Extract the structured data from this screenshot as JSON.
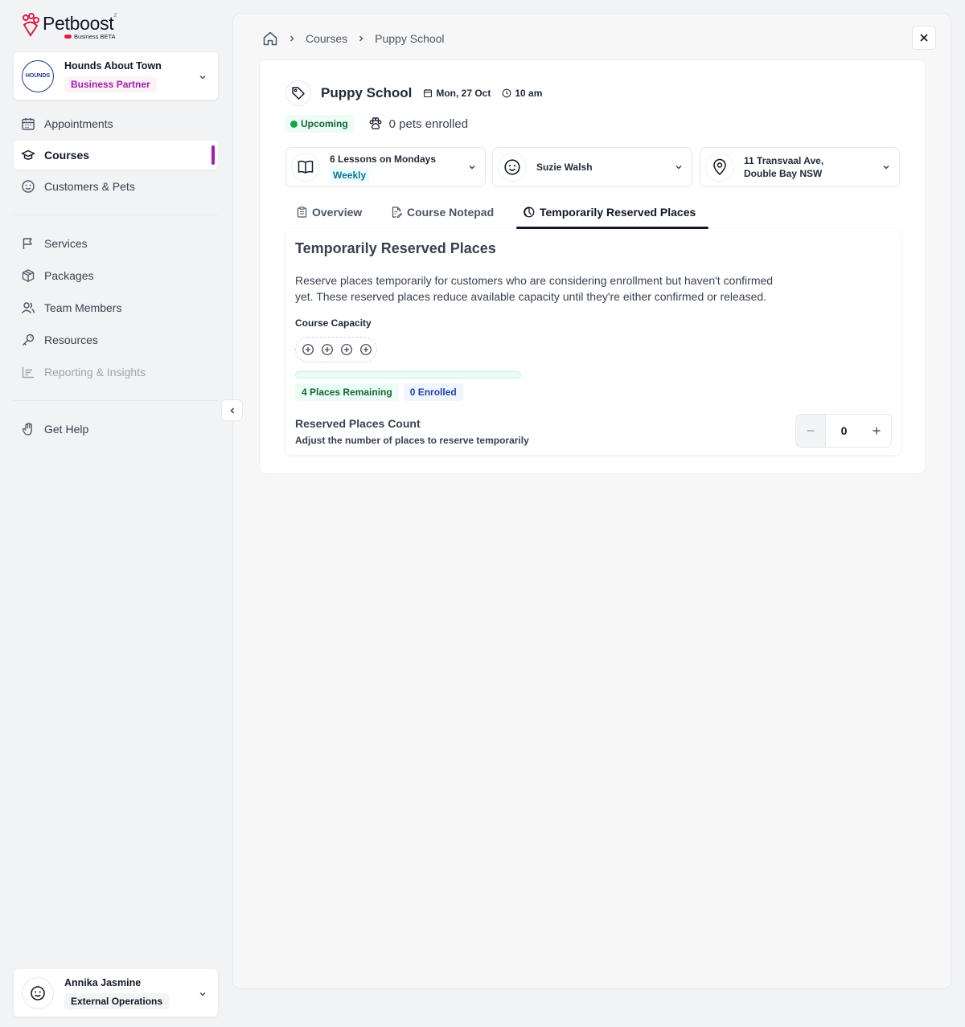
{
  "brand": {
    "name": "Petboost",
    "sup": "2",
    "sub": "Business BETA"
  },
  "org": {
    "name": "Hounds About Town",
    "badge": "Business Partner",
    "logo_text": "HOUNDS"
  },
  "nav": {
    "primary": [
      {
        "label": "Appointments",
        "icon": "calendar-icon"
      },
      {
        "label": "Courses",
        "icon": "graduation-cap-icon",
        "active": true
      },
      {
        "label": "Customers & Pets",
        "icon": "smiley-icon"
      }
    ],
    "secondary": [
      {
        "label": "Services",
        "icon": "flag-icon"
      },
      {
        "label": "Packages",
        "icon": "box-icon"
      },
      {
        "label": "Team Members",
        "icon": "users-icon"
      },
      {
        "label": "Resources",
        "icon": "key-icon"
      },
      {
        "label": "Reporting & Insights",
        "icon": "chart-icon",
        "disabled": true
      }
    ],
    "help": {
      "label": "Get Help",
      "icon": "hand-wave-icon"
    }
  },
  "user": {
    "name": "Annika Jasmine",
    "role": "External Operations"
  },
  "breadcrumb": {
    "items": [
      "Courses",
      "Puppy School"
    ]
  },
  "course": {
    "title": "Puppy School",
    "date": "Mon, 27 Oct",
    "time": "10 am",
    "status": "Upcoming",
    "enrolled_text": "0 pets enrolled",
    "schedule": {
      "line": "6 Lessons on Mondays",
      "frequency": "Weekly"
    },
    "instructor": "Suzie Walsh",
    "location": {
      "line1": "11 Transvaal Ave,",
      "line2": "Double Bay NSW"
    }
  },
  "tabs": [
    {
      "label": "Overview",
      "icon": "clipboard-icon"
    },
    {
      "label": "Course Notepad",
      "icon": "note-icon"
    },
    {
      "label": "Temporarily Reserved Places",
      "icon": "reserve-icon",
      "active": true
    }
  ],
  "reserved": {
    "title": "Temporarily Reserved Places",
    "description": "Reserve places temporarily for customers who are considering enrollment but haven't confirmed yet. These reserved places reduce available capacity until they're either confirmed or released.",
    "capacity_label": "Course Capacity",
    "capacity_slots": 4,
    "enrolled_fraction": 0,
    "remaining_text": "4 Places Remaining",
    "enrolled_text": "0 Enrolled",
    "count_title": "Reserved Places Count",
    "count_subtitle": "Adjust the number of places to reserve temporarily",
    "count_value": "0"
  },
  "colors": {
    "accent": "#a21caf",
    "success": "#16a34a",
    "info": "#1e40af"
  }
}
